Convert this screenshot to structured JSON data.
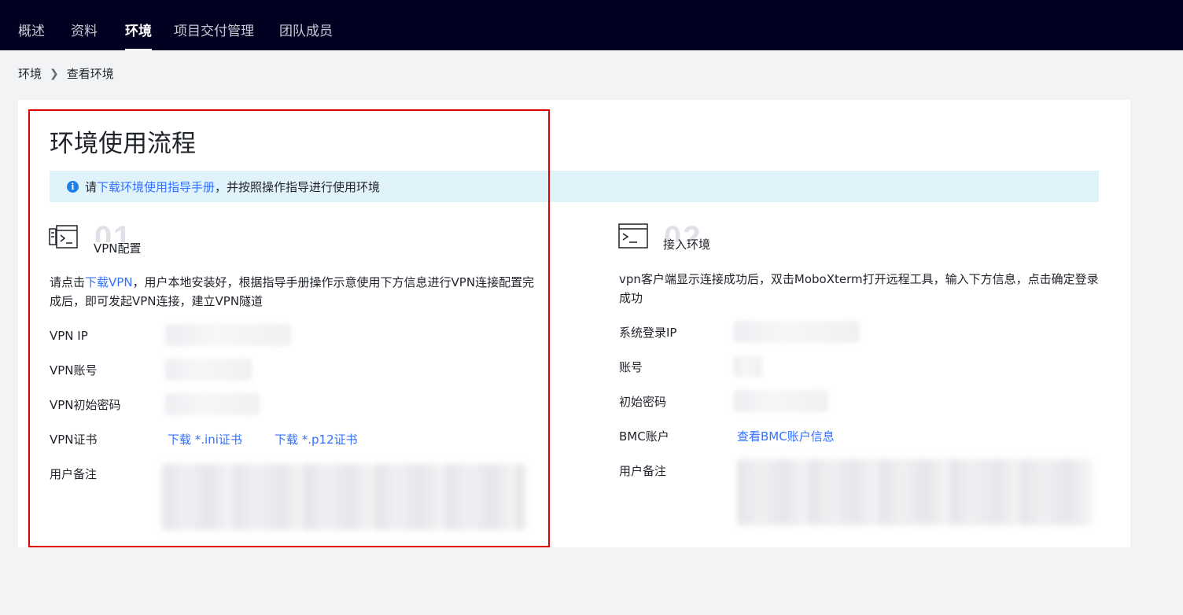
{
  "topnav": {
    "tabs": [
      {
        "label": "概述"
      },
      {
        "label": "资料"
      },
      {
        "label": "环境"
      },
      {
        "label": "项目交付管理"
      },
      {
        "label": "团队成员"
      }
    ],
    "active": "环境"
  },
  "breadcrumb": {
    "root": "环境",
    "current": "查看环境"
  },
  "page": {
    "title": "环境使用流程",
    "notice": {
      "prefix": "请",
      "link": "下载环境使用指导手册",
      "suffix": "，并按照操作指导进行使用环境"
    }
  },
  "step1": {
    "number": "01",
    "title": "VPN配置",
    "desc_prefix": "请点击",
    "desc_link": "下载VPN",
    "desc_suffix": "，用户本地安装好，根据指导手册操作示意使用下方信息进行VPN连接配置完成后，即可发起VPN连接，建立VPN隧道",
    "rows": {
      "ip_label": "VPN IP",
      "account_label": "VPN账号",
      "password_label": "VPN初始密码",
      "cert_label": "VPN证书",
      "cert_ini_link": "下载 *.ini证书",
      "cert_p12_link": "下载 *.p12证书",
      "remark_label": "用户备注"
    }
  },
  "step2": {
    "number": "02",
    "title": "接入环境",
    "desc": "vpn客户端显示连接成功后，双击MoboXterm打开远程工具，输入下方信息，点击确定登录成功",
    "rows": {
      "ip_label": "系统登录IP",
      "account_label": "账号",
      "password_label": "初始密码",
      "bmc_label": "BMC账户",
      "bmc_link": "查看BMC账户信息",
      "remark_label": "用户备注"
    }
  },
  "colors": {
    "nav_bg": "#020122",
    "link": "#3370ff",
    "notice_bg": "#e1f3fa",
    "highlight": "#e00000"
  }
}
